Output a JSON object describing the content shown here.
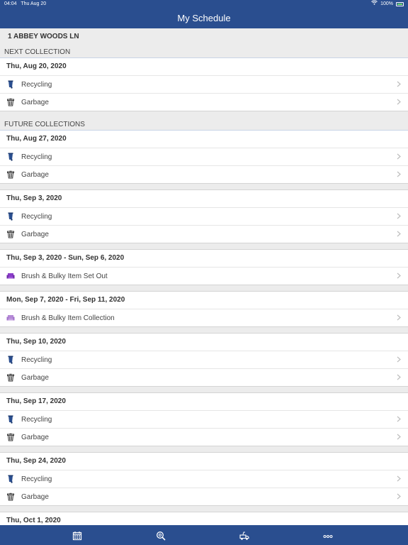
{
  "status": {
    "time": "04:04",
    "date": "Thu Aug 20",
    "battery": "100%"
  },
  "title": "My Schedule",
  "address": "1 ABBEY WOODS LN",
  "next_header": "NEXT COLLECTION",
  "future_header": "FUTURE COLLECTIONS",
  "next": {
    "date": "Thu, Aug 20, 2020",
    "items": [
      {
        "label": "Recycling",
        "icon": "recycling-cart-icon"
      },
      {
        "label": "Garbage",
        "icon": "garbage-can-icon"
      }
    ]
  },
  "future": [
    {
      "date": "Thu, Aug 27, 2020",
      "items": [
        {
          "label": "Recycling"
        },
        {
          "label": "Garbage"
        }
      ]
    },
    {
      "date": "Thu, Sep 3, 2020",
      "items": [
        {
          "label": "Recycling"
        },
        {
          "label": "Garbage"
        }
      ]
    },
    {
      "date": "Thu, Sep 3, 2020 - Sun, Sep 6, 2020",
      "items": [
        {
          "label": "Brush & Bulky Item Set Out"
        }
      ]
    },
    {
      "date": "Mon, Sep 7, 2020 - Fri, Sep 11, 2020",
      "items": [
        {
          "label": "Brush & Bulky Item Collection"
        }
      ]
    },
    {
      "date": "Thu, Sep 10, 2020",
      "items": [
        {
          "label": "Recycling"
        },
        {
          "label": "Garbage"
        }
      ]
    },
    {
      "date": "Thu, Sep 17, 2020",
      "items": [
        {
          "label": "Recycling"
        },
        {
          "label": "Garbage"
        }
      ]
    },
    {
      "date": "Thu, Sep 24, 2020",
      "items": [
        {
          "label": "Recycling"
        },
        {
          "label": "Garbage"
        }
      ]
    },
    {
      "date": "Thu, Oct 1, 2020",
      "items": []
    }
  ],
  "tabs": [
    "calendar-icon",
    "search-icon",
    "truck-icon",
    "more-icon"
  ],
  "colors": {
    "header": "#2a4e8f",
    "recycling": "#2a4e8f",
    "bulky_setout": "#8a3cc9",
    "bulky_collection": "#b58ad6"
  }
}
